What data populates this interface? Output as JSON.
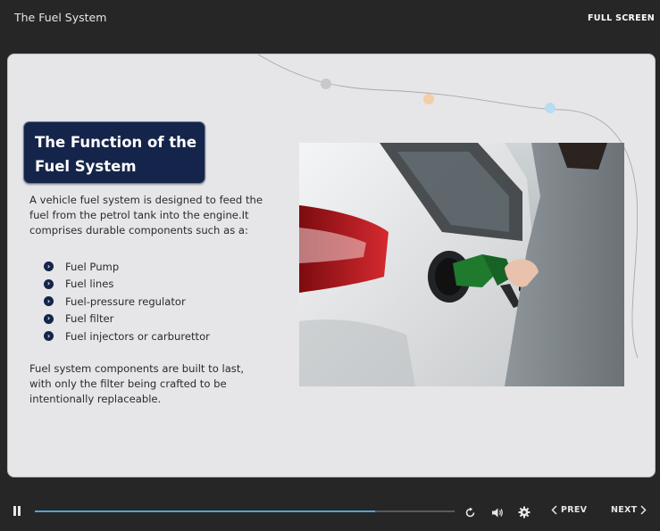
{
  "header": {
    "title": "The Fuel System",
    "fullscreen_label": "FULL SCREEN"
  },
  "slide": {
    "heading_line1": "The Function of the",
    "heading_line2": "Fuel System",
    "intro_lines": [
      "A vehicle fuel system is designed to feed the",
      "fuel from the petrol tank into the engine.It",
      "comprises durable components such as a:"
    ],
    "bullets": [
      "Fuel Pump",
      "Fuel lines",
      "Fuel-pressure regulator",
      "Fuel filter",
      "Fuel injectors or carburettor"
    ],
    "outro_lines": [
      "Fuel system components are built to last,",
      "with only the filter being crafted to be",
      "intentionally replaceable."
    ],
    "decor_dot_colors": [
      "#c8c8c8",
      "#f2cda6",
      "#b9dcf0"
    ],
    "heading_color": "#15244a"
  },
  "player": {
    "progress": 0.81,
    "accent": "#4fa3d8",
    "prev_label": "PREV",
    "next_label": "NEXT",
    "icons": [
      "pause-icon",
      "replay-icon",
      "volume-icon",
      "settings-icon",
      "chevron-left-icon",
      "chevron-right-icon"
    ]
  }
}
